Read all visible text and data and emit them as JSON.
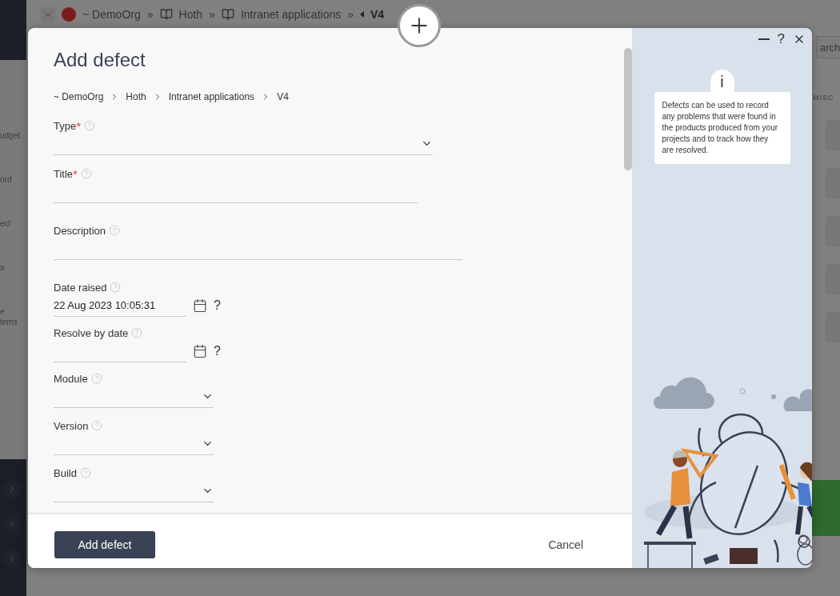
{
  "backdrop": {
    "breadcrumb": [
      {
        "kind": "org",
        "label": "~ DemoOrg"
      },
      {
        "kind": "sep",
        "label": "»"
      },
      {
        "kind": "book",
        "label": "Hoth"
      },
      {
        "kind": "sep",
        "label": "»"
      },
      {
        "kind": "book",
        "label": "Intranet applications"
      },
      {
        "kind": "sep",
        "label": "»"
      },
      {
        "kind": "current",
        "label": "V4"
      }
    ],
    "side_fragments": [
      "udget",
      "ord",
      "ect",
      "a",
      "e\ntems"
    ],
    "search": {
      "placeholder": "arch"
    },
    "section_label": "MISC"
  },
  "dialog": {
    "title": "Add defect",
    "path": [
      "~ DemoOrg",
      "Hoth",
      "Intranet applications",
      "V4"
    ],
    "fields": [
      {
        "kind": "dropdown",
        "label": "Type",
        "required_mark": "*"
      },
      {
        "kind": "text",
        "label": "Title",
        "required_mark": "*"
      },
      {
        "kind": "textarea",
        "label": "Description"
      },
      {
        "kind": "date",
        "label": "Date raised",
        "value": "22 Aug 2023 10:05:31",
        "help_mark": "?"
      },
      {
        "kind": "date",
        "label": "Resolve by date",
        "help_mark": "?"
      },
      {
        "kind": "select",
        "label": "Module"
      },
      {
        "kind": "select",
        "label": "Version"
      },
      {
        "kind": "select",
        "label": "Build"
      }
    ],
    "submit": "Add defect",
    "cancel": "Cancel",
    "window_controls": {
      "help": "?"
    },
    "info": {
      "icon": "i",
      "text": "Defects can be used to record any problems that were found in the products produced from your projects and to track how they are resolved."
    }
  }
}
